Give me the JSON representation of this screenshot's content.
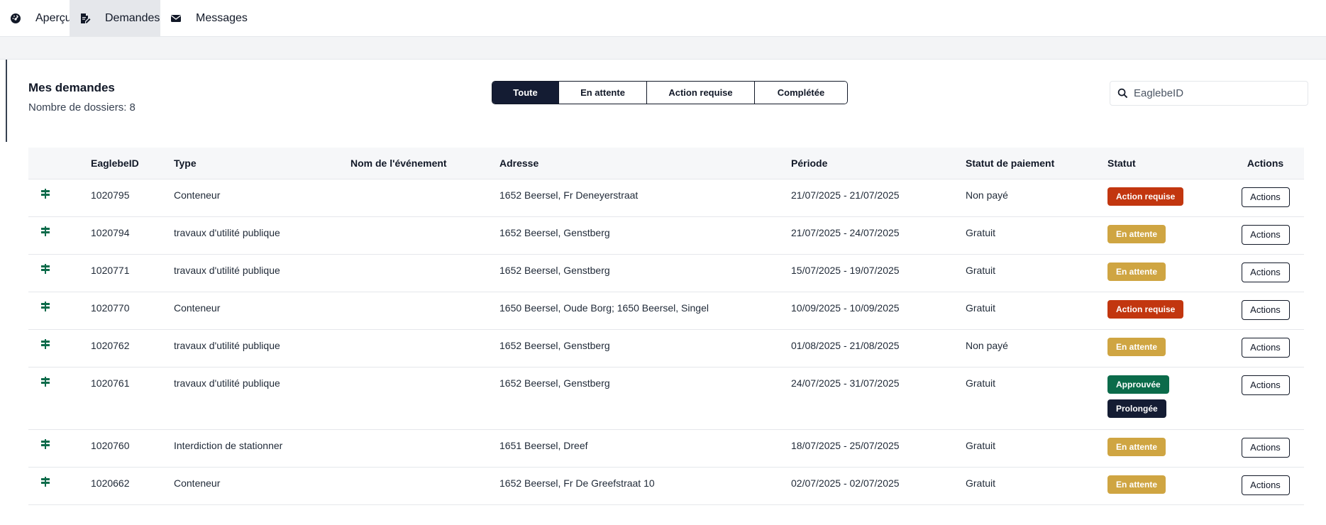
{
  "nav": {
    "tabs": [
      {
        "label": "Aperçu",
        "icon": "dashboard-icon",
        "active": false
      },
      {
        "label": "Demandes",
        "icon": "edit-document-icon",
        "active": true
      },
      {
        "label": "Messages",
        "icon": "envelope-icon",
        "active": false
      }
    ]
  },
  "header": {
    "title": "Mes demandes",
    "count": "Nombre de dossiers: 8"
  },
  "filters": {
    "options": [
      "Toute",
      "En attente",
      "Action requise",
      "Complétée"
    ],
    "selected": "Toute"
  },
  "search": {
    "placeholder": "EaglebeID",
    "value": ""
  },
  "table": {
    "columns": [
      "",
      "EaglebeID",
      "Type",
      "Nom de l'événement",
      "Adresse",
      "Période",
      "Statut de paiement",
      "Statut",
      "Actions"
    ],
    "rows": [
      {
        "id": "1020795",
        "type": "Conteneur",
        "event": "",
        "address": "1652 Beersel, Fr Deneyerstraat",
        "period": "21/07/2025 - 21/07/2025",
        "payment": "Non payé",
        "statuses": [
          "Action requise"
        ],
        "action": "Actions"
      },
      {
        "id": "1020794",
        "type": "travaux d'utilité publique",
        "event": "",
        "address": "1652 Beersel, Genstberg",
        "period": "21/07/2025 - 24/07/2025",
        "payment": "Gratuit",
        "statuses": [
          "En attente"
        ],
        "action": "Actions"
      },
      {
        "id": "1020771",
        "type": "travaux d'utilité publique",
        "event": "",
        "address": "1652 Beersel, Genstberg",
        "period": "15/07/2025 - 19/07/2025",
        "payment": "Gratuit",
        "statuses": [
          "En attente"
        ],
        "action": "Actions"
      },
      {
        "id": "1020770",
        "type": "Conteneur",
        "event": "",
        "address": "1650 Beersel, Oude Borg; 1650 Beersel, Singel",
        "period": "10/09/2025 - 10/09/2025",
        "payment": "Gratuit",
        "statuses": [
          "Action requise"
        ],
        "action": "Actions"
      },
      {
        "id": "1020762",
        "type": "travaux d'utilité publique",
        "event": "",
        "address": "1652 Beersel, Genstberg",
        "period": "01/08/2025 - 21/08/2025",
        "payment": "Non payé",
        "statuses": [
          "En attente"
        ],
        "action": "Actions"
      },
      {
        "id": "1020761",
        "type": "travaux d'utilité publique",
        "event": "",
        "address": "1652 Beersel, Genstberg",
        "period": "24/07/2025 - 31/07/2025",
        "payment": "Gratuit",
        "statuses": [
          "Approuvée",
          "Prolongée"
        ],
        "action": "Actions"
      },
      {
        "id": "1020760",
        "type": "Interdiction de stationner",
        "event": "",
        "address": "1651 Beersel, Dreef",
        "period": "18/07/2025 - 25/07/2025",
        "payment": "Gratuit",
        "statuses": [
          "En attente"
        ],
        "action": "Actions"
      },
      {
        "id": "1020662",
        "type": "Conteneur",
        "event": "",
        "address": "1652 Beersel, Fr De Greefstraat 10",
        "period": "02/07/2025 - 02/07/2025",
        "payment": "Gratuit",
        "statuses": [
          "En attente"
        ],
        "action": "Actions"
      }
    ],
    "row_icon": "signpost-icon"
  },
  "colors": {
    "action_required": "#c2360f",
    "pending": "#cfa542",
    "approved": "#0b6b4a",
    "extended": "#141c33",
    "row_icon": "#0b6b4a"
  }
}
